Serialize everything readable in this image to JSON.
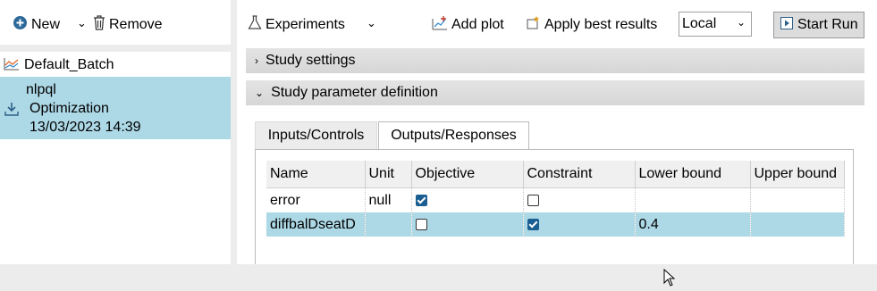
{
  "left_toolbar": {
    "new_label": "New",
    "remove_label": "Remove"
  },
  "study_list": {
    "batch_label": "Default_Batch",
    "selected": {
      "name": "nlpql",
      "type": "Optimization",
      "date": "13/03/2023 14:39"
    }
  },
  "right_toolbar": {
    "experiments_label": "Experiments",
    "add_plot_label": "Add plot",
    "apply_best_label": "Apply best results",
    "location_value": "Local",
    "start_run_label": "Start Run"
  },
  "sections": {
    "study_settings": "Study settings",
    "parameter_definition": "Study parameter definition"
  },
  "tabs": {
    "inputs": "Inputs/Controls",
    "outputs": "Outputs/Responses"
  },
  "table": {
    "columns": [
      "Name",
      "Unit",
      "Objective",
      "Constraint",
      "Lower bound",
      "Upper bound"
    ],
    "rows": [
      {
        "name": "error",
        "unit": "null",
        "objective": true,
        "constraint": false,
        "lower": "",
        "upper": ""
      },
      {
        "name": "diffbalDseatD",
        "unit": "",
        "objective": false,
        "constraint": true,
        "lower": "0.4",
        "upper": ""
      }
    ]
  },
  "colors": {
    "selection": "#add8e6",
    "checkbox": "#1b5f92",
    "panel_bg": "#ececec"
  }
}
